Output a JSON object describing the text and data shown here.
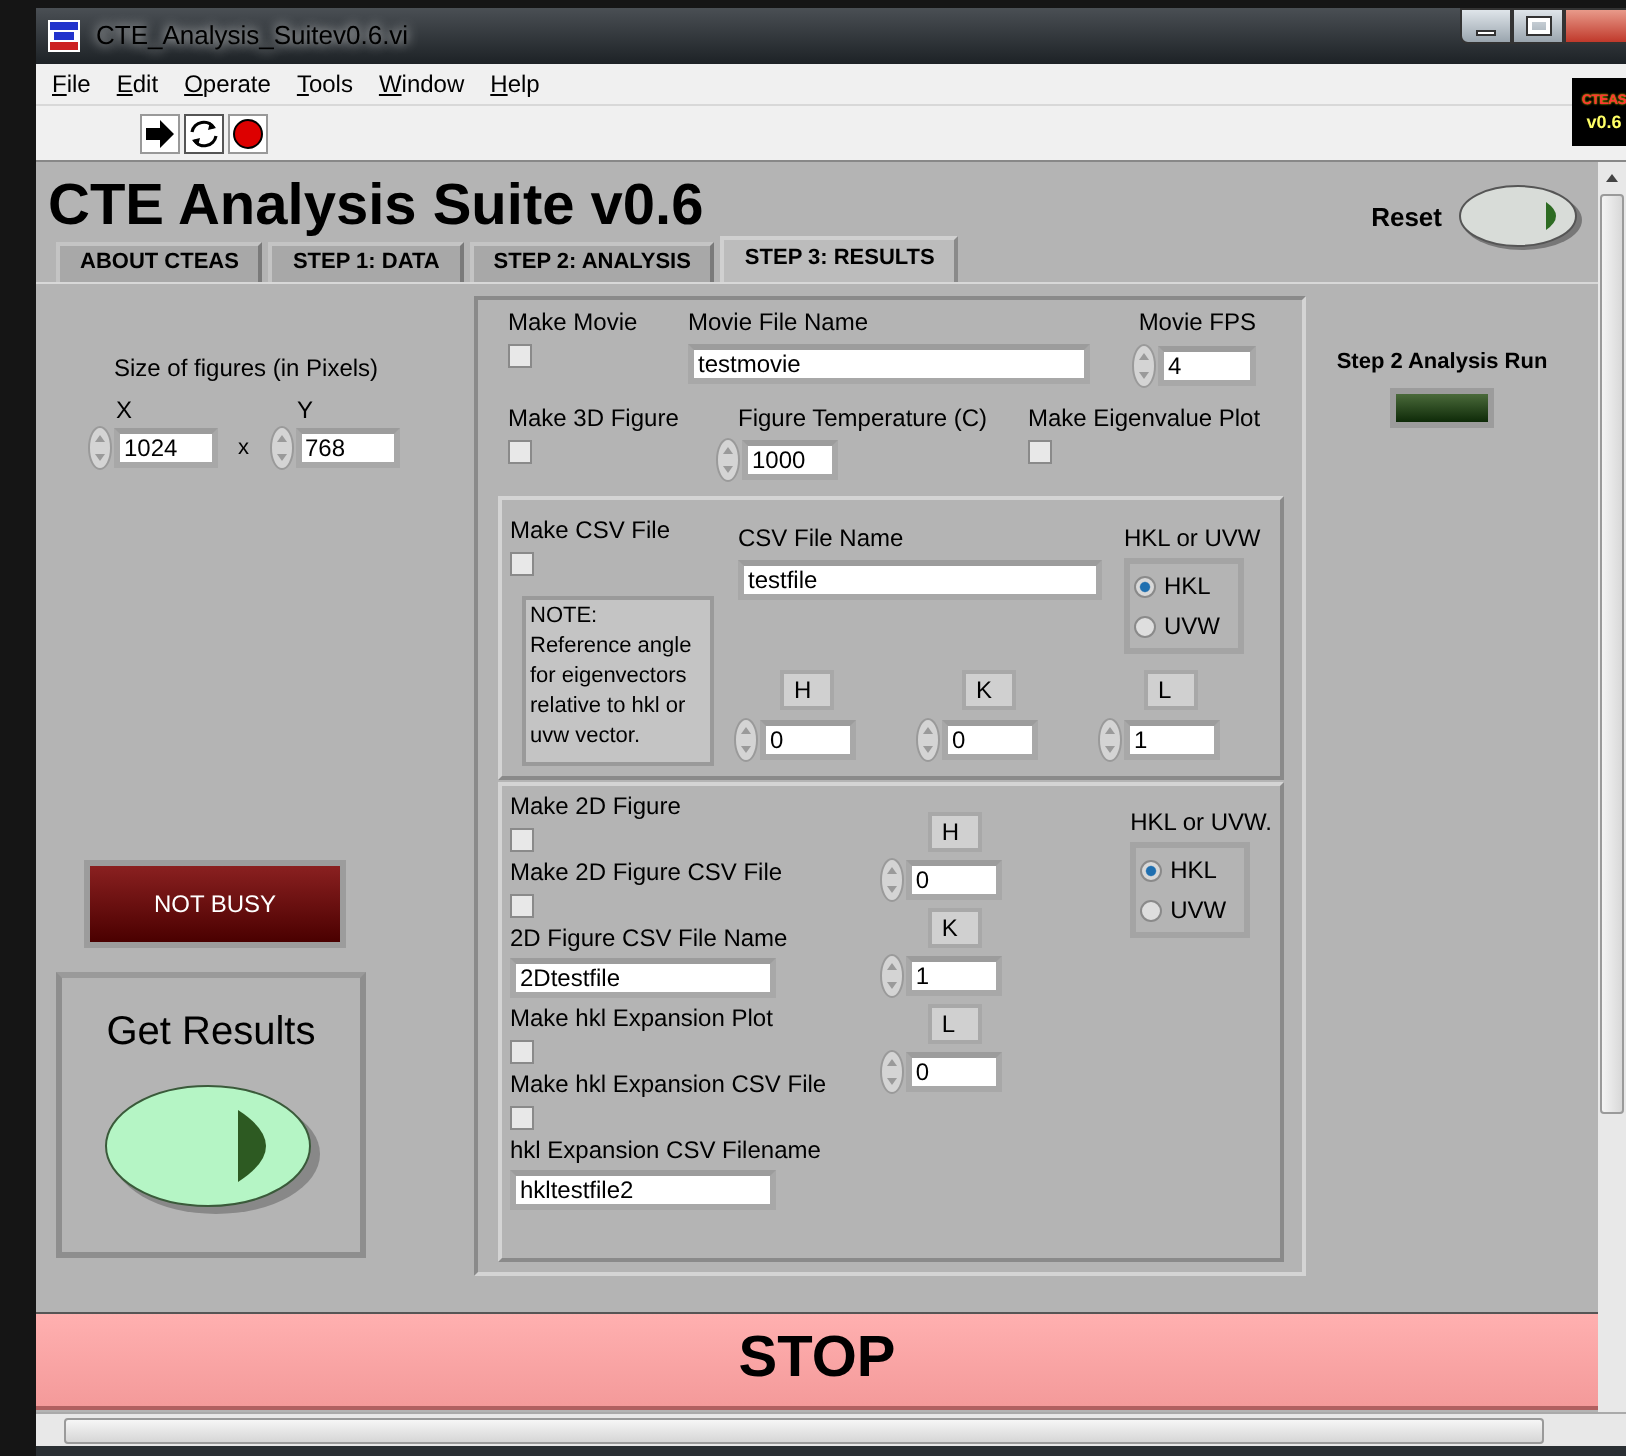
{
  "window": {
    "title": "CTE_Analysis_Suitev0.6.vi"
  },
  "menu": [
    "File",
    "Edit",
    "Operate",
    "Tools",
    "Window",
    "Help"
  ],
  "toolbar": [
    {
      "kind": "run"
    },
    {
      "kind": "run_continuously"
    },
    {
      "kind": "abort"
    }
  ],
  "vi_icon": {
    "line_1": "CTEAS",
    "line_2": "v0.6"
  },
  "panel": {
    "title": "CTE Analysis Suite v0.6",
    "reset": {
      "label": "Reset"
    }
  },
  "tabs": [
    {
      "label": "ABOUT CTEAS",
      "selected": false
    },
    {
      "label": "STEP 1: DATA",
      "selected": false
    },
    {
      "label": "STEP 2: ANALYSIS",
      "selected": false
    },
    {
      "label": "STEP 3: RESULTS",
      "selected": true
    }
  ],
  "figure_size": {
    "label": "Size of figures (in Pixels)",
    "x": {
      "label": "X",
      "value": "1024"
    },
    "separator": "x",
    "y": {
      "label": "Y",
      "value": "768"
    }
  },
  "busy": {
    "label": "NOT BUSY",
    "on": false
  },
  "get_results": {
    "label": "Get Results"
  },
  "outputs": {
    "make_movie": {
      "label": "Make Movie",
      "checked": false
    },
    "movie_file_name": {
      "label": "Movie File Name",
      "value": "testmovie"
    },
    "movie_fps": {
      "label": "Movie FPS",
      "value": "4"
    },
    "make_3d_figure": {
      "label": "Make 3D Figure",
      "checked": false
    },
    "figure_temperature": {
      "label": "Figure Temperature (C)",
      "value": "1000"
    },
    "make_eigenvalue_plot": {
      "label": "Make Eigenvalue Plot",
      "checked": false
    }
  },
  "csv": {
    "make_csv": {
      "label": "Make CSV File",
      "checked": false
    },
    "file_name": {
      "label": "CSV File Name",
      "value": "testfile"
    },
    "note": "NOTE:\nReference angle for eigenvectors relative to hkl or uvw vector.",
    "basis": {
      "label": "HKL or UVW",
      "options": [
        {
          "label": "HKL",
          "selected": true
        },
        {
          "label": "UVW",
          "selected": false
        }
      ]
    },
    "vector": [
      {
        "label": "H",
        "value": "0"
      },
      {
        "label": "K",
        "value": "0"
      },
      {
        "label": "L",
        "value": "1"
      }
    ]
  },
  "figure_2d": {
    "make_2d_figure": {
      "label": "Make 2D Figure",
      "checked": false
    },
    "make_2d_csv": {
      "label": "Make 2D Figure CSV File",
      "checked": false
    },
    "csv_file_name": {
      "label": "2D Figure CSV File Name",
      "value": "2Dtestfile"
    },
    "make_hkl_plot": {
      "label": "Make hkl Expansion Plot",
      "checked": false
    },
    "make_hkl_csv": {
      "label": "Make hkl Expansion CSV File",
      "checked": false
    },
    "hkl_csv_file_name": {
      "label": "hkl Expansion CSV Filename",
      "value": "hkltestfile2"
    },
    "vector": [
      {
        "label": "H",
        "value": "0"
      },
      {
        "label": "K",
        "value": "1"
      },
      {
        "label": "L",
        "value": "0"
      }
    ],
    "basis": {
      "label": "HKL or UVW.",
      "options": [
        {
          "label": "HKL",
          "selected": true
        },
        {
          "label": "UVW",
          "selected": false
        }
      ]
    }
  },
  "step2_indicator": {
    "label": "Step 2 Analysis Run",
    "on": false
  },
  "stop": {
    "label": "STOP"
  }
}
